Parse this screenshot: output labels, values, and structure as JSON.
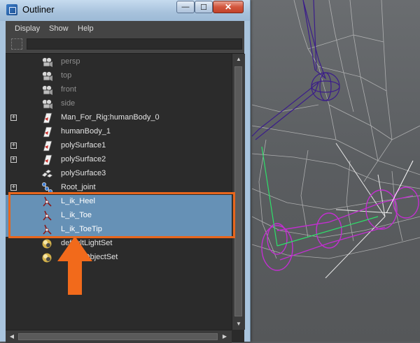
{
  "window": {
    "title": "Outliner",
    "minimize_glyph": "—",
    "maximize_glyph": "☐",
    "close_glyph": "✕"
  },
  "menu": {
    "display": "Display",
    "show": "Show",
    "help": "Help"
  },
  "filter": {
    "value": ""
  },
  "rows": [
    {
      "label": "persp",
      "icon": "camera-icon",
      "expandable": false,
      "selected": false,
      "dim": true
    },
    {
      "label": "top",
      "icon": "camera-icon",
      "expandable": false,
      "selected": false,
      "dim": true
    },
    {
      "label": "front",
      "icon": "camera-icon",
      "expandable": false,
      "selected": false,
      "dim": true
    },
    {
      "label": "side",
      "icon": "camera-icon",
      "expandable": false,
      "selected": false,
      "dim": true
    },
    {
      "label": "Man_For_Rig:humanBody_0",
      "icon": "mesh-icon",
      "expandable": true,
      "selected": false,
      "dim": false
    },
    {
      "label": "humanBody_1",
      "icon": "mesh-icon",
      "expandable": false,
      "selected": false,
      "dim": false
    },
    {
      "label": "polySurface1",
      "icon": "mesh-icon",
      "expandable": true,
      "selected": false,
      "dim": false
    },
    {
      "label": "polySurface2",
      "icon": "mesh-icon",
      "expandable": true,
      "selected": false,
      "dim": false
    },
    {
      "label": "polySurface3",
      "icon": "poly-group-icon",
      "expandable": false,
      "selected": false,
      "dim": false
    },
    {
      "label": "Root_joint",
      "icon": "joint-icon",
      "expandable": true,
      "selected": false,
      "dim": false
    },
    {
      "label": "L_ik_Heel",
      "icon": "ik-handle-icon",
      "expandable": false,
      "selected": true,
      "dim": false
    },
    {
      "label": "L_ik_Toe",
      "icon": "ik-handle-icon",
      "expandable": false,
      "selected": true,
      "dim": false
    },
    {
      "label": "L_ik_ToeTip",
      "icon": "ik-handle-icon",
      "expandable": false,
      "selected": true,
      "dim": false
    },
    {
      "label": "defaultLightSet",
      "icon": "set-icon",
      "expandable": false,
      "selected": false,
      "dim": false
    },
    {
      "label": "defaultObjectSet",
      "icon": "set-icon",
      "expandable": false,
      "selected": false,
      "dim": false
    }
  ],
  "expander_glyph": "+",
  "scroll_glyphs": {
    "up": "▲",
    "down": "▼",
    "left": "◀",
    "right": "▶"
  },
  "colors": {
    "selection": "#6691b6",
    "highlight_box": "#e8661c",
    "arrow": "#f26a1b",
    "wireframe": "#c8c8c8",
    "joint_purple": "#3b1d8a",
    "ik_magenta": "#c22fd0",
    "axis_green": "#2ee06a"
  }
}
